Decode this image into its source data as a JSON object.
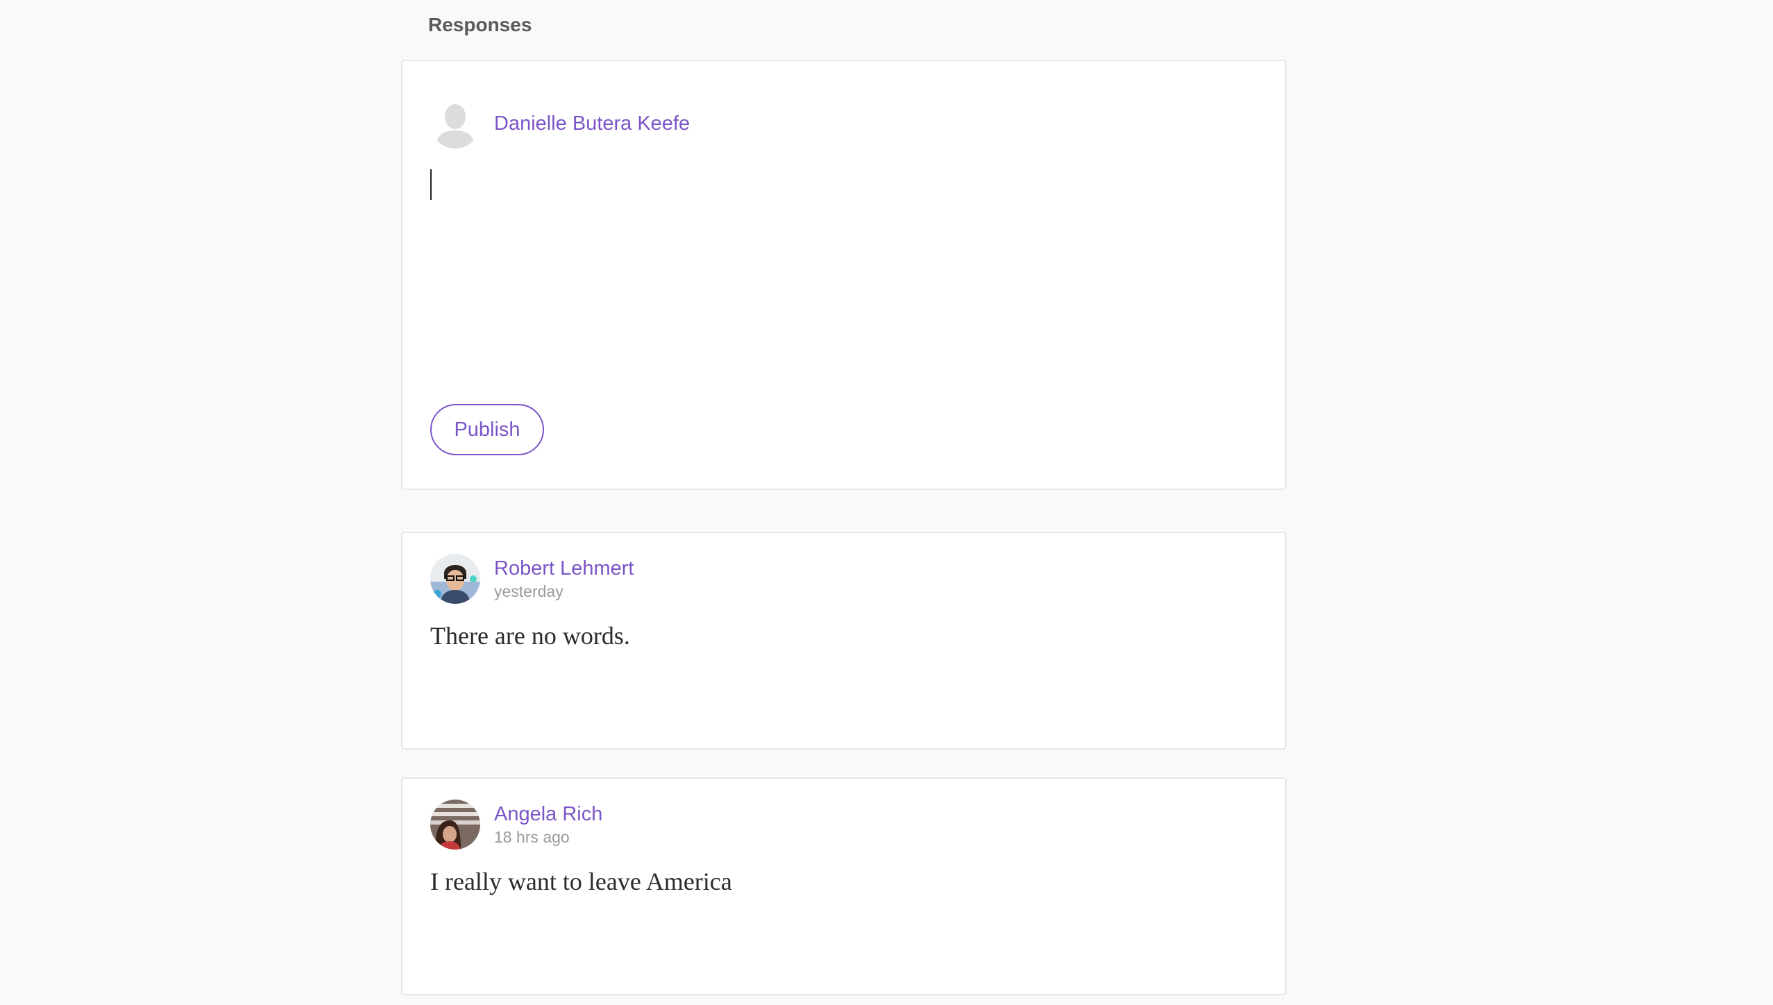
{
  "section": {
    "title": "Responses"
  },
  "compose": {
    "author_name": "Danielle Butera Keefe",
    "text": "",
    "publish_label": "Publish"
  },
  "responses": [
    {
      "author_name": "Robert Lehmert",
      "timestamp": "yesterday",
      "text": "There are no words."
    },
    {
      "author_name": "Angela Rich",
      "timestamp": "18 hrs ago",
      "text": "I really want to leave America"
    }
  ],
  "colors": {
    "accent": "#7b55c7",
    "background": "#f9f9f9",
    "card": "#ffffff",
    "border": "#e6e6e6",
    "muted_text": "#9a9a9a"
  },
  "icons": {
    "compose_avatar": "default-user-silhouette-icon"
  }
}
